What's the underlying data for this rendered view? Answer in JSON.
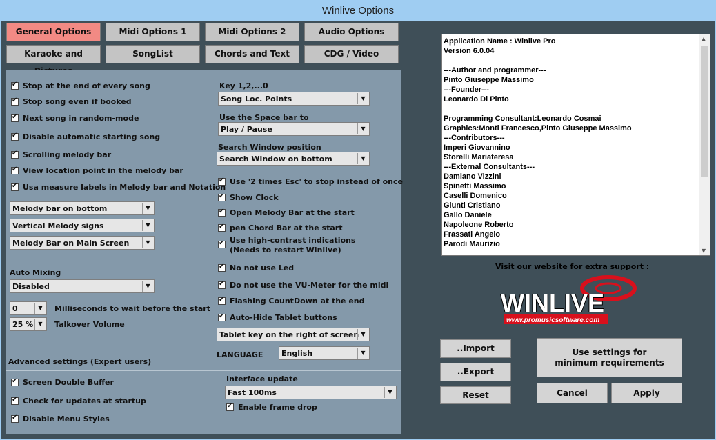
{
  "window": {
    "title": "Winlive  Options"
  },
  "tabs": [
    {
      "label": "General Options"
    },
    {
      "label": "Midi Options 1"
    },
    {
      "label": "Midi Options 2"
    },
    {
      "label": "Audio Options"
    },
    {
      "label": "Karaoke and Pictures"
    },
    {
      "label": "SongList"
    },
    {
      "label": "Chords and Text"
    },
    {
      "label": "CDG / Video"
    }
  ],
  "left_checks": [
    "Stop at the end of every song",
    "Stop song even if booked",
    "Next song in random-mode",
    "Disable automatic starting song",
    "Scrolling melody bar",
    "View location point in the melody bar",
    "Usa measure labels in Melody bar and Notation"
  ],
  "left_combos": [
    "Melody bar on bottom",
    "Vertical Melody signs",
    "Melody Bar on Main Screen"
  ],
  "auto_mixing": {
    "label": "Auto Mixing",
    "value": "Disabled"
  },
  "wait": {
    "value": "0",
    "label": "Milliseconds to wait before the start"
  },
  "talkover": {
    "value": "25 %",
    "label": "Talkover Volume"
  },
  "advanced": {
    "label": "Advanced settings (Expert users)",
    "checks": [
      "Screen Double Buffer",
      "Check for updates at startup",
      "Disable Menu Styles"
    ]
  },
  "key": {
    "label": "Key 1,2,...0",
    "value": "Song Loc. Points"
  },
  "space": {
    "label": "Use the Space bar to",
    "value": "Play / Pause"
  },
  "search": {
    "label": "Search Window position",
    "value": "Search Window on bottom"
  },
  "right_checks": [
    "Use '2 times Esc' to stop instead of once",
    "Show Clock",
    "Open Melody Bar at the start",
    "pen Chord Bar at the start"
  ],
  "contrast": {
    "line1": "Use high-contrast indications",
    "line2": "(Needs to restart Winlive)"
  },
  "right_checks2": [
    "No not use Led",
    "Do not use the VU-Meter for the midi",
    "Flashing CountDown at the end",
    "Auto-Hide Tablet buttons"
  ],
  "tablet_key": {
    "value": "Tablet key on the right of screen"
  },
  "language": {
    "label": "LANGUAGE",
    "value": "English"
  },
  "interface": {
    "label": "Interface update",
    "value": "Fast 100ms",
    "frame_drop": "Enable frame drop"
  },
  "about_lines": [
    "Application Name : Winlive Pro",
    "Version 6.0.04",
    "",
    "---Author and programmer---",
    "Pinto Giuseppe Massimo",
    "---Founder---",
    "Leonardo Di Pinto",
    "",
    "Programming Consultant:Leonardo Cosmai",
    "Graphics:Monti Francesco,Pinto Giuseppe Massimo",
    "---Contributors---",
    "Imperi Giovannino",
    "Storelli Mariateresa",
    "---External Consultants---",
    "Damiano Vizzini",
    "Spinetti Massimo",
    "Caselli Domenico",
    "Giunti Cristiano",
    "Gallo Daniele",
    "Napoleone Roberto",
    "Frassati Angelo",
    "Parodi Maurizio"
  ],
  "support": "Visit our website for extra support :",
  "logo": {
    "text": "WINLIVE",
    "url": "www.promusicsoftware.com"
  },
  "buttons": {
    "import": "..Import",
    "export": "..Export",
    "reset": "Reset",
    "min_req": "Use settings for minimum requirements",
    "cancel": "Cancel",
    "apply": "Apply"
  },
  "colors": {
    "active_tab": "#f28a84",
    "panel": "#8499aa",
    "client": "#3f4f58",
    "logo_red": "#d8101c"
  }
}
